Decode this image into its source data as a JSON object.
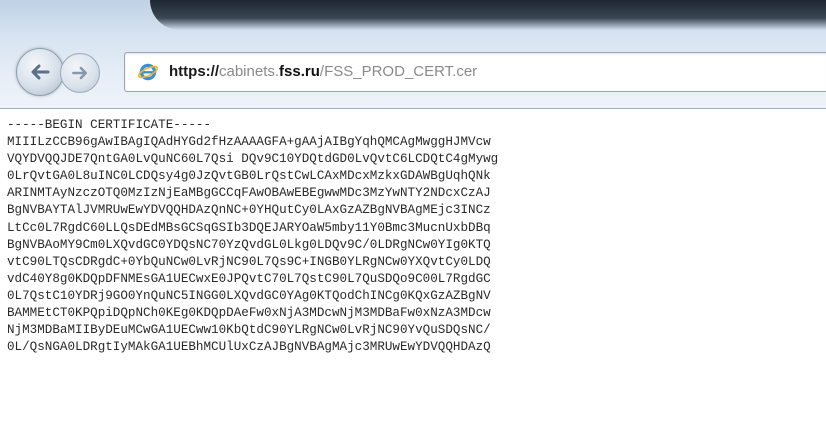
{
  "browser": {
    "back_icon": "back-arrow-icon",
    "forward_icon": "forward-arrow-icon",
    "site_icon": "internet-explorer-icon",
    "address": {
      "scheme": "https://",
      "domain_prefix": "cabinets.",
      "domain": "fss.ru",
      "path": "/FSS_PROD_CERT.cer"
    }
  },
  "document": {
    "lines": [
      "-----BEGIN CERTIFICATE-----",
      "MIIILzCCB96gAwIBAgIQAdHYGd2fHzAAAAGFA+gAAjAIBgYqhQMCAgMwggHJMVcw",
      "VQYDVQQJDE7QntGA0LvQuNC60L7Qsi DQv9C10YDQtdGD0LvQvtC6LCDQtC4gMywg",
      "0LrQvtGA0L8uINC0LCDQsy4g0JzQvtGB0LrQstCwLCAxMDcxMzkxGDAWBgUqhQNk",
      "ARINMTAyNzczOTQ0MzIzNjEaMBgGCCqFAwOBAwEBEgwwMDc3MzYwNTY2NDcxCzAJ",
      "BgNVBAYTAlJVMRUwEwYDVQQHDAzQnNC+0YHQutCy0LAxGzAZBgNVBAgMEjc3INCz",
      "LtCc0L7RgdC60LLQsDEdMBsGCSqGSIb3DQEJARYOaW5mby11Y0Bmc3MucnUxbDBq",
      "BgNVBAoMY9Cm0LXQvdGC0YDQsNC70YzQvdGL0Lkg0LDQv9C/0LDRgNCw0YIg0KTQ",
      "vtC90LTQsCDRgdC+0YbQuNCw0LvRjNC90L7Qs9C+INGB0YLRgNCw0YXQvtCy0LDQ",
      "vdC40Y8g0KDQpDFNMEsGA1UECwxE0JPQvtC70L7QstC90L7QuSDQo9C00L7RgdGC",
      "0L7QstC10YDRj9GO0YnQuNC5INGG0LXQvdGC0YAg0KTQodChINCg0KQxGzAZBgNV",
      "BAMMEtCT0KPQpiDQpNCh0KEg0KDQpDAeFw0xNjA3MDcwNjM3MDBaFw0xNzA3MDcw",
      "NjM3MDBaMIIByDEuMCwGA1UECww10KbQtdC90YLRgNCw0LvRjNC90YvQuSDQsNC/",
      "0L/QsNGA0LDRgtIyMAkGA1UEBhMCUlUxCzAJBgNVBAgMAjc3MRUwEwYDVQQHDAzQ"
    ]
  }
}
